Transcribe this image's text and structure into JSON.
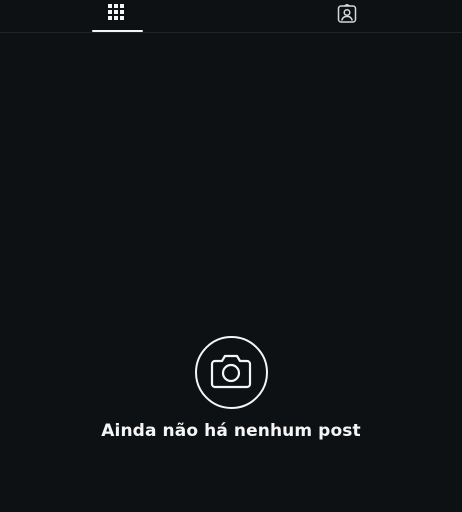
{
  "tabs": [
    {
      "name": "posts-grid",
      "icon": "grid-icon",
      "active": true
    },
    {
      "name": "tagged",
      "icon": "tagged-person-icon",
      "active": false
    }
  ],
  "empty_state": {
    "icon": "camera-icon",
    "message": "Ainda não há nenhum post"
  },
  "colors": {
    "background": "#0e1114",
    "foreground": "#f5f5f5",
    "divider": "#1f2327"
  }
}
